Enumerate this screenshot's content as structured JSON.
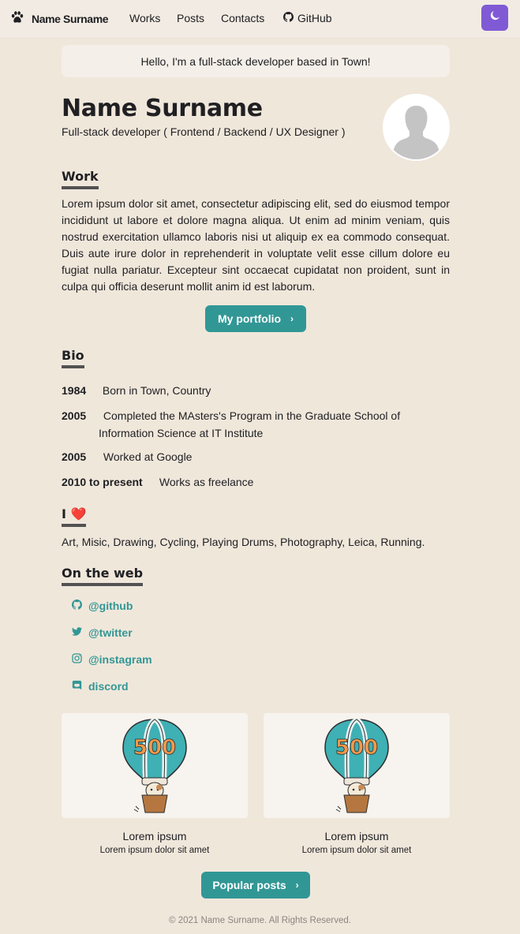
{
  "navbar": {
    "brand": "Name Surname",
    "links": [
      "Works",
      "Posts",
      "Contacts",
      "GitHub"
    ],
    "icons": {
      "logo": "paw-icon",
      "github": "github-icon",
      "theme": "moon-icon"
    }
  },
  "hello": "Hello, I'm a full-stack developer based in Town!",
  "profile": {
    "name": "Name Surname",
    "subtitle": "Full-stack developer ( Frontend / Backend / UX Designer )"
  },
  "work": {
    "title": "Work",
    "text": "Lorem ipsum dolor sit amet, consectetur adipiscing elit, sed do eiusmod tempor incididunt ut labore et dolore magna aliqua. Ut enim ad minim veniam, quis nostrud exercitation ullamco laboris nisi ut aliquip ex ea commodo consequat. Duis aute irure dolor in reprehenderit in voluptate velit esse cillum dolore eu fugiat nulla pariatur. Excepteur sint occaecat cupidatat non proident, sunt in culpa qui officia deserunt mollit anim id est laborum.",
    "button": "My portfolio"
  },
  "bio": {
    "title": "Bio",
    "entries": [
      {
        "year": "1984",
        "text": "Born in Town, Country"
      },
      {
        "year": "2005",
        "text": "Completed the MAsters's Program in the Graduate School of",
        "text2": "Information Science at IT Institute"
      },
      {
        "year": "2005",
        "text": "Worked at Google"
      },
      {
        "year": "2010 to present",
        "text": "Works as freelance"
      }
    ]
  },
  "love": {
    "title": "I",
    "heart": "❤️",
    "text": "Art, Misic, Drawing, Cycling, Playing Drums, Photography, Leica, Running."
  },
  "web": {
    "title": "On the web",
    "links": [
      {
        "label": "@github",
        "icon": "github-icon"
      },
      {
        "label": "@twitter",
        "icon": "twitter-icon"
      },
      {
        "label": "@instagram",
        "icon": "instagram-icon"
      },
      {
        "label": "discord",
        "icon": "discord-icon"
      }
    ]
  },
  "posts": [
    {
      "title": "Lorem ipsum",
      "desc": "Lorem ipsum dolor sit amet"
    },
    {
      "title": "Lorem ipsum",
      "desc": "Lorem ipsum dolor sit amet"
    }
  ],
  "posts_button": "Popular posts",
  "footer": "© 2021 Name Surname. All Rights Reserved.",
  "colors": {
    "background": "#f0e7db",
    "accent": "#319795",
    "theme_button": "#805ad5"
  }
}
